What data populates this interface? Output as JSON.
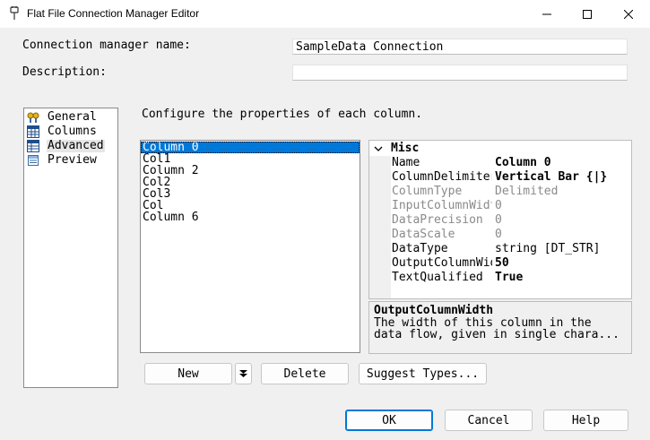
{
  "window": {
    "title": "Flat File Connection Manager Editor",
    "icons": [
      "app-plug-icon",
      "minimize-icon",
      "maximize-icon",
      "close-icon"
    ]
  },
  "form": {
    "connection_name_label": "Connection manager name:",
    "connection_name_value": "SampleData Connection",
    "description_label": "Description:",
    "description_value": ""
  },
  "nav": {
    "items": [
      {
        "label": "General",
        "icon": "general-icon"
      },
      {
        "label": "Columns",
        "icon": "columns-icon"
      },
      {
        "label": "Advanced",
        "icon": "advanced-icon",
        "selected": true
      },
      {
        "label": "Preview",
        "icon": "preview-icon"
      }
    ]
  },
  "advanced": {
    "instruction": "Configure the properties of each column.",
    "columns": [
      "Column 0",
      "Col1",
      "Column 2",
      "Col2",
      "Col3",
      "Col",
      "Column 6"
    ],
    "selected_column": "Column 0",
    "category": "Misc",
    "properties": [
      {
        "name": "Name",
        "value": "Column 0"
      },
      {
        "name": "ColumnDelimiter",
        "value": "Vertical Bar {|}"
      },
      {
        "name": "ColumnType",
        "value": "Delimited"
      },
      {
        "name": "InputColumnWidth",
        "value": "0"
      },
      {
        "name": "DataPrecision",
        "value": "0"
      },
      {
        "name": "DataScale",
        "value": "0"
      },
      {
        "name": "DataType",
        "value": "string [DT_STR]"
      },
      {
        "name": "OutputColumnWidth",
        "value": "50"
      },
      {
        "name": "TextQualified",
        "value": "True"
      }
    ],
    "description_title": "OutputColumnWidth",
    "description_line1": "The width of this column in the",
    "description_line2": "data flow, given in single chara..."
  },
  "buttons": {
    "new": "New",
    "delete": "Delete",
    "suggest": "Suggest Types...",
    "ok": "OK",
    "cancel": "Cancel",
    "help": "Help"
  },
  "colors": {
    "selection": "#0078d7",
    "window_bg": "#f0f0f0"
  }
}
